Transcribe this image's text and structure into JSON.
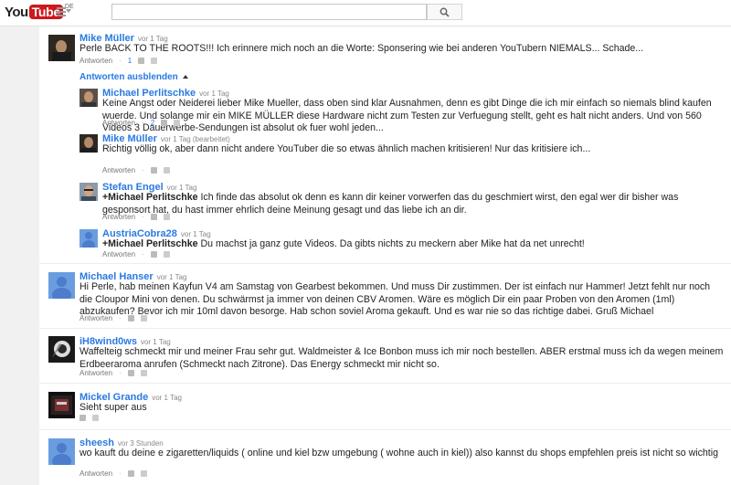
{
  "header": {
    "logo_you": "You",
    "logo_tube": "Tube",
    "logo_region": "DE",
    "search_placeholder": ""
  },
  "actions_label": "Antworten",
  "comments": [
    {
      "author": "Mike Müller",
      "time": "vor 1 Tag",
      "text": "Perle BACK TO THE ROOTS!!! Ich erinnere mich noch an die Worte: Sponsering wie bei anderen YouTubern NIEMALS... Schade...",
      "likes": "1",
      "toggle_label": "Antworten ausblenden",
      "replies": [
        {
          "author": "Michael Perlitschke",
          "time": "vor 1 Tag",
          "text": "Keine Angst oder Neiderei lieber Mike Mueller, dass oben sind klar Ausnahmen, denn es gibt Dinge die ich mir einfach so niemals blind kaufen wuerde. Und solange mir ein MIKE MÜLLER diese Hardware nicht zum Testen zur Verfuegung stellt, geht es halt nicht anders. Und von 560 Videos 3 Dauerwerbe-Sendungen ist absolut ok fuer wohl jeden...",
          "likes": "2"
        },
        {
          "author": "Mike Müller",
          "time": "vor 1 Tag (bearbeitet)",
          "text": "Richtig völlig ok, aber dann nicht andere YouTuber die so etwas ähnlich machen kritisieren! Nur das kritisiere ich..."
        },
        {
          "author": "Stefan Engel",
          "time": "vor 1 Tag",
          "mention": "+Michael Perlitschke",
          "text": " Ich finde das absolut ok denn es kann dir keiner vorwerfen das du geschmiert wirst, den egal wer dir bisher was gesponsort hat, du hast immer ehrlich deine Meinung gesagt und das liebe ich an dir."
        },
        {
          "author": "AustriaCobra28",
          "time": "vor 1 Tag",
          "mention": "+Michael Perlitschke",
          "text": " Du machst ja ganz gute Videos. Da gibts nichts zu meckern aber Mike hat da net unrecht!"
        }
      ]
    },
    {
      "author": "Michael Hanser",
      "time": "vor 1 Tag",
      "text": "Hi Perle, hab meinen Kayfun V4 am Samstag von Gearbest bekommen. Und muss Dir zustimmen. Der ist einfach nur Hammer! Jetzt fehlt nur noch die Cloupor Mini von denen. Du schwärmst ja immer von deinen CBV Aromen. Wäre es möglich Dir ein paar Proben von den Aromen (1ml) abzukaufen? Bevor ich mir 10ml davon besorge. Hab schon soviel Aroma gekauft. Und es war nie so das richtige dabei. Gruß Michael"
    },
    {
      "author": "iH8wind0ws",
      "time": "vor 1 Tag",
      "text": "Waffelteig schmeckt mir und meiner Frau sehr gut. Waldmeister & Ice Bonbon muss ich mir noch bestellen. ABER erstmal muss ich da wegen meinem Erdbeeraroma anrufen (Schmeckt nach Zitrone).  Das Energy schmeckt mir nicht so."
    },
    {
      "author": "Mickel Grande",
      "time": "vor 1 Tag",
      "text": "Sieht super aus"
    },
    {
      "author": "sheesh",
      "time": "vor 3 Stunden",
      "text": "wo kauft du deine e zigaretten/liquids ( online und kiel bzw umgebung ( wohne auch in kiel)) also kannst du shops empfehlen preis ist nicht so wichtig"
    }
  ]
}
